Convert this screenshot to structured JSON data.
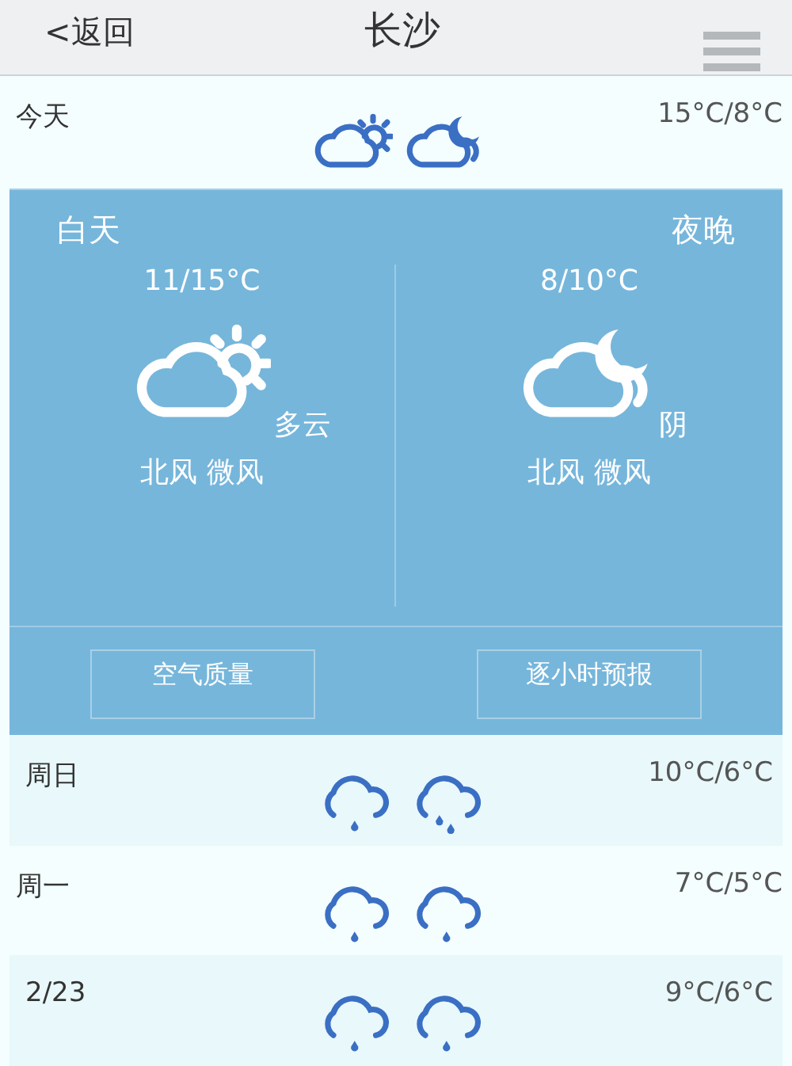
{
  "header": {
    "back": "<返回",
    "title": "长沙"
  },
  "today": {
    "label": "今天",
    "icons": [
      {
        "kind": "sun_cloud"
      },
      {
        "kind": "moon_cloud"
      }
    ],
    "temp": "15°C/8°C"
  },
  "detail": {
    "periods": [
      {
        "label": "白天",
        "temp": "11/15°C",
        "kind": "sun_cloud",
        "condition": "多云",
        "wind": "北风 微风"
      },
      {
        "label": "夜晚",
        "temp": "8/10°C",
        "kind": "moon_cloud",
        "condition": "阴",
        "wind": "北风 微风"
      }
    ],
    "buttons": [
      "空气质量",
      "逐小时预报"
    ]
  },
  "forecast": [
    {
      "label": "周日",
      "icons": [
        {
          "kind": "rain_one"
        },
        {
          "kind": "rain_two"
        }
      ],
      "temp": "10°C/6°C"
    },
    {
      "label": "周一",
      "icons": [
        {
          "kind": "rain_one"
        },
        {
          "kind": "rain_one"
        }
      ],
      "temp": "7°C/5°C"
    },
    {
      "label": "2/23",
      "icons": [
        {
          "kind": "rain_one"
        },
        {
          "kind": "rain_one"
        }
      ],
      "temp": "9°C/6°C"
    }
  ]
}
